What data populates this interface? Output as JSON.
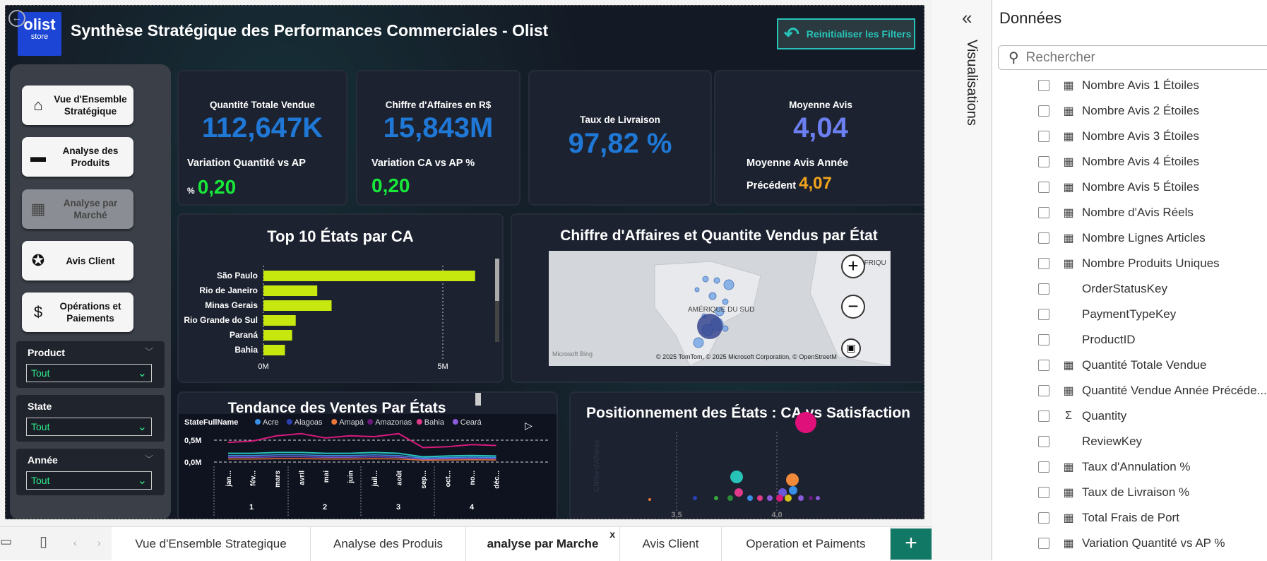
{
  "report": {
    "title": "Synthèse Stratégique des Performances Commerciales - Olist",
    "logo_line1": "olist",
    "logo_line2": "store",
    "reset_label": "Reinitialiser les Filters"
  },
  "nav": [
    {
      "label": "Vue d'Ensemble Stratégique",
      "icon": "home-icon"
    },
    {
      "label": "Analyse des Produits",
      "icon": "box-icon"
    },
    {
      "label": "Analyse par Marché",
      "icon": "store-icon"
    },
    {
      "label": "Avis Client",
      "icon": "star-bubble-icon"
    },
    {
      "label": "Opérations et Paiements",
      "icon": "dollar-icon"
    }
  ],
  "slicers": [
    {
      "label": "Product",
      "value": "Tout"
    },
    {
      "label": "State",
      "value": "Tout"
    },
    {
      "label": "Année",
      "value": "Tout"
    }
  ],
  "kpis": {
    "qty": {
      "label": "Quantité Totale Vendue",
      "value": "112,647K",
      "sub_label": "Variation Quantité vs AP",
      "sub_prefix": "%",
      "sub_value": "0,20"
    },
    "ca": {
      "label": "Chiffre d'Affaires en R$",
      "value": "15,843M",
      "sub_label": "Variation CA vs AP %",
      "sub_value": "0,20"
    },
    "livraison": {
      "label": "Taux de Livraison",
      "value": "97,82 %"
    },
    "avis": {
      "label": "Moyenne Avis",
      "value": "4,04",
      "sub_label1": "Moyenne Avis Année",
      "sub_label2": "Précédent",
      "sub_value": "4,07"
    }
  },
  "bar_panel": {
    "title": "Top 10 États par CA"
  },
  "map_panel": {
    "title": "Chiffre d'Affaires et Quantite Vendus par État",
    "region_label": "AMÉRIQUE DU SUD",
    "region_label2": "AFRIQU",
    "attribution": "© 2025 TomTom, © 2025 Microsoft Corporation, © OpenStreetM",
    "bing": "Microsoft Bing"
  },
  "line_panel": {
    "title": "Tendance des Ventes Par États",
    "legend_title": "StateFullName"
  },
  "scatter_panel": {
    "title": "Positionnement des États : CA vs Satisfaction",
    "y_axis": "Chiffre d'Affaires"
  },
  "chart_data": [
    {
      "type": "bar",
      "categories": [
        "São Paulo",
        "Rio de Janeiro",
        "Minas Gerais",
        "Rio Grande do Sul",
        "Paraná",
        "Bahia"
      ],
      "values": [
        5.9,
        1.5,
        1.9,
        0.9,
        0.8,
        0.6
      ],
      "xlim": [
        0,
        6
      ],
      "x_ticks": [
        "0M",
        "5M"
      ]
    },
    {
      "type": "line",
      "series": [
        {
          "name": "Acre",
          "color": "#3a8ee6"
        },
        {
          "name": "Alagoas",
          "color": "#2b3fb0"
        },
        {
          "name": "Amapá",
          "color": "#e9773a"
        },
        {
          "name": "Amazonas",
          "color": "#6b1a7a"
        },
        {
          "name": "Bahia",
          "color": "#e03a8a"
        },
        {
          "name": "Ceará",
          "color": "#8a5ad8"
        }
      ],
      "y_ticks": [
        "0,5M",
        "0,0M"
      ],
      "months": [
        "jan...",
        "fév...",
        "mars",
        "avril",
        "mai",
        "juin",
        "juil...",
        "août",
        "sep...",
        "oct...",
        "no...",
        "déc..."
      ],
      "quarters": [
        "1",
        "2",
        "3",
        "4"
      ],
      "highlight_values": [
        0.45,
        0.48,
        0.6,
        0.65,
        0.55,
        0.6,
        0.58,
        0.65,
        0.33,
        0.35,
        0.4,
        0.38
      ],
      "other_values": [
        0.2,
        0.2,
        0.22,
        0.22,
        0.2,
        0.2,
        0.22,
        0.2,
        0.12,
        0.14,
        0.15,
        0.14
      ]
    },
    {
      "type": "scatter",
      "x_ticks": [
        "3,5",
        "4,0"
      ]
    }
  ],
  "tabs": [
    "Vue d'Ensemble Strategique",
    "Analyse des Produis",
    "analyse par Marche",
    "Avis Client",
    "Operation et Paiments"
  ],
  "right_panel": {
    "header": "Données",
    "viz_label": "Visualisations",
    "search_placeholder": "Rechercher",
    "fields": [
      {
        "label": "Nombre Avis 1 Étoiles",
        "icon": "calc"
      },
      {
        "label": "Nombre Avis 2 Étoiles",
        "icon": "calc"
      },
      {
        "label": "Nombre Avis 3 Étoiles",
        "icon": "calc"
      },
      {
        "label": "Nombre Avis 4 Étoiles",
        "icon": "calc"
      },
      {
        "label": "Nombre Avis 5 Étoiles",
        "icon": "calc"
      },
      {
        "label": "Nombre d'Avis Réels",
        "icon": "calc"
      },
      {
        "label": "Nombre Lignes Articles",
        "icon": "calc"
      },
      {
        "label": "Nombre Produits Uniques",
        "icon": "calc"
      },
      {
        "label": "OrderStatusKey",
        "icon": ""
      },
      {
        "label": "PaymentTypeKey",
        "icon": ""
      },
      {
        "label": "ProductID",
        "icon": ""
      },
      {
        "label": "Quantité Totale Vendue",
        "icon": "calc"
      },
      {
        "label": "Quantité Vendue Année Précéde...",
        "icon": "calc"
      },
      {
        "label": "Quantity",
        "icon": "sigma"
      },
      {
        "label": "ReviewKey",
        "icon": ""
      },
      {
        "label": "Taux d'Annulation %",
        "icon": "calc"
      },
      {
        "label": "Taux de Livraison %",
        "icon": "calc"
      },
      {
        "label": "Total Frais de Port",
        "icon": "calc"
      },
      {
        "label": "Variation Quantité vs AP %",
        "icon": "calc"
      }
    ]
  }
}
